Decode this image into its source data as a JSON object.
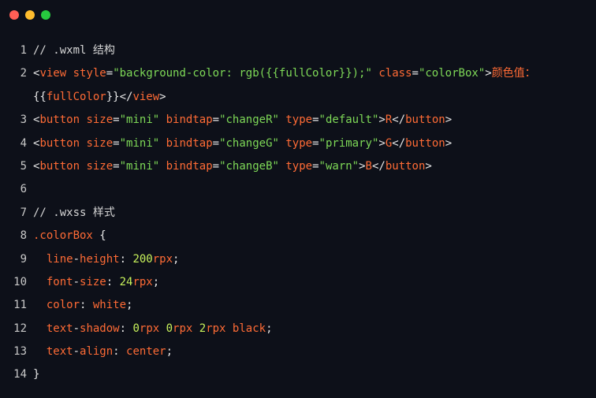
{
  "window": {
    "buttons": [
      "close",
      "minimize",
      "maximize"
    ],
    "colors": {
      "close": "#ff5f56",
      "minimize": "#ffbd2e",
      "maximize": "#27c93f"
    }
  },
  "code_lines": [
    {
      "num": "1",
      "tokens": [
        {
          "t": "// .wxml 结构",
          "c": "c-comment"
        }
      ]
    },
    {
      "num": "2",
      "tokens": [
        {
          "t": "<",
          "c": "c-punct"
        },
        {
          "t": "view",
          "c": "c-tag"
        },
        {
          "t": " ",
          "c": "c-plain"
        },
        {
          "t": "style",
          "c": "c-attr"
        },
        {
          "t": "=",
          "c": "c-punct"
        },
        {
          "t": "\"background-color: rgb({{fullColor}});\"",
          "c": "c-str"
        },
        {
          "t": " ",
          "c": "c-plain"
        },
        {
          "t": "class",
          "c": "c-attr"
        },
        {
          "t": "=",
          "c": "c-punct"
        },
        {
          "t": "\"colorBox\"",
          "c": "c-str"
        },
        {
          "t": ">",
          "c": "c-punct"
        },
        {
          "t": "颜色值：",
          "c": "c-text"
        }
      ]
    },
    {
      "num": "",
      "tokens": [
        {
          "t": "{{",
          "c": "c-punct"
        },
        {
          "t": "fullColor",
          "c": "c-text"
        },
        {
          "t": "}}",
          "c": "c-punct"
        },
        {
          "t": "</",
          "c": "c-punct"
        },
        {
          "t": "view",
          "c": "c-tag"
        },
        {
          "t": ">",
          "c": "c-punct"
        }
      ]
    },
    {
      "num": "3",
      "tokens": [
        {
          "t": "<",
          "c": "c-punct"
        },
        {
          "t": "button",
          "c": "c-tag"
        },
        {
          "t": " ",
          "c": "c-plain"
        },
        {
          "t": "size",
          "c": "c-attr"
        },
        {
          "t": "=",
          "c": "c-punct"
        },
        {
          "t": "\"mini\"",
          "c": "c-str"
        },
        {
          "t": " ",
          "c": "c-plain"
        },
        {
          "t": "bindtap",
          "c": "c-attr"
        },
        {
          "t": "=",
          "c": "c-punct"
        },
        {
          "t": "\"changeR\"",
          "c": "c-str"
        },
        {
          "t": " ",
          "c": "c-plain"
        },
        {
          "t": "type",
          "c": "c-attr"
        },
        {
          "t": "=",
          "c": "c-punct"
        },
        {
          "t": "\"default\"",
          "c": "c-str"
        },
        {
          "t": ">",
          "c": "c-punct"
        },
        {
          "t": "R",
          "c": "c-text"
        },
        {
          "t": "</",
          "c": "c-punct"
        },
        {
          "t": "button",
          "c": "c-tag"
        },
        {
          "t": ">",
          "c": "c-punct"
        }
      ]
    },
    {
      "num": "4",
      "tokens": [
        {
          "t": "<",
          "c": "c-punct"
        },
        {
          "t": "button",
          "c": "c-tag"
        },
        {
          "t": " ",
          "c": "c-plain"
        },
        {
          "t": "size",
          "c": "c-attr"
        },
        {
          "t": "=",
          "c": "c-punct"
        },
        {
          "t": "\"mini\"",
          "c": "c-str"
        },
        {
          "t": " ",
          "c": "c-plain"
        },
        {
          "t": "bindtap",
          "c": "c-attr"
        },
        {
          "t": "=",
          "c": "c-punct"
        },
        {
          "t": "\"changeG\"",
          "c": "c-str"
        },
        {
          "t": " ",
          "c": "c-plain"
        },
        {
          "t": "type",
          "c": "c-attr"
        },
        {
          "t": "=",
          "c": "c-punct"
        },
        {
          "t": "\"primary\"",
          "c": "c-str"
        },
        {
          "t": ">",
          "c": "c-punct"
        },
        {
          "t": "G",
          "c": "c-text"
        },
        {
          "t": "</",
          "c": "c-punct"
        },
        {
          "t": "button",
          "c": "c-tag"
        },
        {
          "t": ">",
          "c": "c-punct"
        }
      ]
    },
    {
      "num": "5",
      "tokens": [
        {
          "t": "<",
          "c": "c-punct"
        },
        {
          "t": "button",
          "c": "c-tag"
        },
        {
          "t": " ",
          "c": "c-plain"
        },
        {
          "t": "size",
          "c": "c-attr"
        },
        {
          "t": "=",
          "c": "c-punct"
        },
        {
          "t": "\"mini\"",
          "c": "c-str"
        },
        {
          "t": " ",
          "c": "c-plain"
        },
        {
          "t": "bindtap",
          "c": "c-attr"
        },
        {
          "t": "=",
          "c": "c-punct"
        },
        {
          "t": "\"changeB\"",
          "c": "c-str"
        },
        {
          "t": " ",
          "c": "c-plain"
        },
        {
          "t": "type",
          "c": "c-attr"
        },
        {
          "t": "=",
          "c": "c-punct"
        },
        {
          "t": "\"warn\"",
          "c": "c-str"
        },
        {
          "t": ">",
          "c": "c-punct"
        },
        {
          "t": "B",
          "c": "c-text"
        },
        {
          "t": "</",
          "c": "c-punct"
        },
        {
          "t": "button",
          "c": "c-tag"
        },
        {
          "t": ">",
          "c": "c-punct"
        }
      ]
    },
    {
      "num": "6",
      "tokens": []
    },
    {
      "num": "7",
      "tokens": [
        {
          "t": "// .wxss 样式",
          "c": "c-comment"
        }
      ]
    },
    {
      "num": "8",
      "tokens": [
        {
          "t": ".colorBox",
          "c": "c-sel"
        },
        {
          "t": " {",
          "c": "c-punct"
        }
      ]
    },
    {
      "num": "9",
      "tokens": [
        {
          "t": "  line",
          "c": "c-prop"
        },
        {
          "t": "-",
          "c": "c-punct"
        },
        {
          "t": "height",
          "c": "c-prop"
        },
        {
          "t": ": ",
          "c": "c-punct"
        },
        {
          "t": "200",
          "c": "c-num"
        },
        {
          "t": "rpx",
          "c": "c-val"
        },
        {
          "t": ";",
          "c": "c-punct"
        }
      ]
    },
    {
      "num": "10",
      "tokens": [
        {
          "t": "  font",
          "c": "c-prop"
        },
        {
          "t": "-",
          "c": "c-punct"
        },
        {
          "t": "size",
          "c": "c-prop"
        },
        {
          "t": ": ",
          "c": "c-punct"
        },
        {
          "t": "24",
          "c": "c-num"
        },
        {
          "t": "rpx",
          "c": "c-val"
        },
        {
          "t": ";",
          "c": "c-punct"
        }
      ]
    },
    {
      "num": "11",
      "tokens": [
        {
          "t": "  color",
          "c": "c-prop"
        },
        {
          "t": ": ",
          "c": "c-punct"
        },
        {
          "t": "white",
          "c": "c-val"
        },
        {
          "t": ";",
          "c": "c-punct"
        }
      ]
    },
    {
      "num": "12",
      "tokens": [
        {
          "t": "  text",
          "c": "c-prop"
        },
        {
          "t": "-",
          "c": "c-punct"
        },
        {
          "t": "shadow",
          "c": "c-prop"
        },
        {
          "t": ": ",
          "c": "c-punct"
        },
        {
          "t": "0",
          "c": "c-num"
        },
        {
          "t": "rpx ",
          "c": "c-val"
        },
        {
          "t": "0",
          "c": "c-num"
        },
        {
          "t": "rpx ",
          "c": "c-val"
        },
        {
          "t": "2",
          "c": "c-num"
        },
        {
          "t": "rpx black",
          "c": "c-val"
        },
        {
          "t": ";",
          "c": "c-punct"
        }
      ]
    },
    {
      "num": "13",
      "tokens": [
        {
          "t": "  text",
          "c": "c-prop"
        },
        {
          "t": "-",
          "c": "c-punct"
        },
        {
          "t": "align",
          "c": "c-prop"
        },
        {
          "t": ": ",
          "c": "c-punct"
        },
        {
          "t": "center",
          "c": "c-val"
        },
        {
          "t": ";",
          "c": "c-punct"
        }
      ]
    },
    {
      "num": "14",
      "tokens": [
        {
          "t": "}",
          "c": "c-punct"
        }
      ]
    }
  ]
}
